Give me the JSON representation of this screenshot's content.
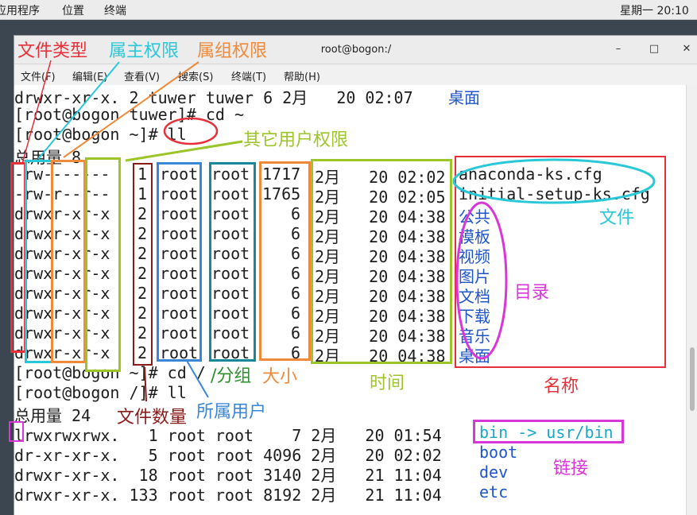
{
  "system_bar": {
    "app_menu": "应用程序",
    "places": "位置",
    "terminal": "终端",
    "clock": "星期一 20:10"
  },
  "window": {
    "title": "root@bogon:/",
    "minimize": "–",
    "maximize": "□",
    "close": "✕"
  },
  "menu": [
    "文件(F)",
    "编辑(E)",
    "查看(V)",
    "搜索(S)",
    "终端(T)",
    "帮助(H)"
  ],
  "terminal": {
    "line_top": "drwxr-xr-x. 2 tuwer tuwer 6 2月   20 02:07",
    "line_top_name": "桌面",
    "prompt1": "[root@bogon tuwer]# cd ~",
    "prompt2": "[root@bogon ~]# ll",
    "total1": "总用量 8",
    "listing1": [
      {
        "perm": "-rw-------",
        "links": "1",
        "owner": "root",
        "group": "root",
        "size": "1717",
        "date": "2月   20 02:02",
        "name": "anaconda-ks.cfg"
      },
      {
        "perm": "-rw-r--r--",
        "links": "1",
        "owner": "root",
        "group": "root",
        "size": "1765",
        "date": "2月   20 02:05",
        "name": "initial-setup-ks.cfg"
      },
      {
        "perm": "drwxr-xr-x",
        "links": "2",
        "owner": "root",
        "group": "root",
        "size": "6",
        "date": "2月   20 04:38",
        "name": "公共"
      },
      {
        "perm": "drwxr-xr-x",
        "links": "2",
        "owner": "root",
        "group": "root",
        "size": "6",
        "date": "2月   20 04:38",
        "name": "模板"
      },
      {
        "perm": "drwxr-xr-x",
        "links": "2",
        "owner": "root",
        "group": "root",
        "size": "6",
        "date": "2月   20 04:38",
        "name": "视频"
      },
      {
        "perm": "drwxr-xr-x",
        "links": "2",
        "owner": "root",
        "group": "root",
        "size": "6",
        "date": "2月   20 04:38",
        "name": "图片"
      },
      {
        "perm": "drwxr-xr-x",
        "links": "2",
        "owner": "root",
        "group": "root",
        "size": "6",
        "date": "2月   20 04:38",
        "name": "文档"
      },
      {
        "perm": "drwxr-xr-x",
        "links": "2",
        "owner": "root",
        "group": "root",
        "size": "6",
        "date": "2月   20 04:38",
        "name": "下载"
      },
      {
        "perm": "drwxr-xr-x",
        "links": "2",
        "owner": "root",
        "group": "root",
        "size": "6",
        "date": "2月   20 04:38",
        "name": "音乐"
      },
      {
        "perm": "drwxr-xr-x",
        "links": "2",
        "owner": "root",
        "group": "root",
        "size": "6",
        "date": "2月   20 04:38",
        "name": "桌面"
      }
    ],
    "prompt3": "[root@bogon ~]# cd /",
    "prompt4": "[root@bogon /]# ll",
    "total2": "总用量 24",
    "listing2": [
      {
        "text": "lrwxrwxrwx.   1 root root    7 2月   20 01:54 ",
        "name": "bin -> usr/bin"
      },
      {
        "text": "dr-xr-xr-x.   5 root root 4096 2月   20 02:02 ",
        "name": "boot"
      },
      {
        "text": "drwxr-xr-x.  18 root root 3140 2月   21 11:04 ",
        "name": "dev"
      },
      {
        "text": "drwxr-xr-x. 133 root root 8192 2月   21 11:04 ",
        "name": "etc"
      }
    ]
  },
  "annotations": {
    "file_type": "文件类型",
    "owner_perm": "属主权限",
    "group_perm": "属组权限",
    "other_perm": "其它用户权限",
    "file": "文件",
    "directory": "目录",
    "group": "/分组",
    "size": "大小",
    "time": "时间",
    "name": "名称",
    "file_count": "文件数量",
    "owner": "所属用户",
    "link": "链接"
  },
  "colors": {
    "red": "#e8303a",
    "cyan": "#29c8d8",
    "orange": "#ef8a3a",
    "green": "#9cc52a",
    "blue": "#3a86d8",
    "teal": "#17879a",
    "magenta": "#d936d9",
    "darkred": "#8b1a1a"
  }
}
